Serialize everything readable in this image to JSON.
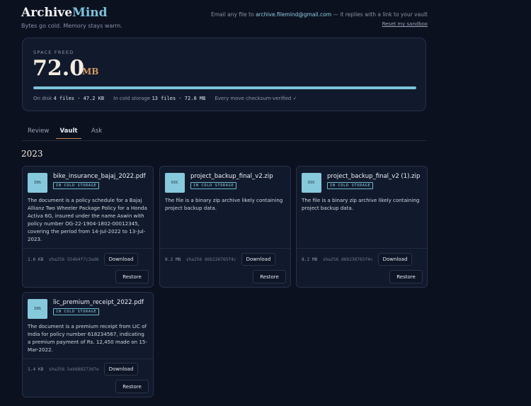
{
  "header": {
    "brand_main": "Archive",
    "brand_accent": "Mind",
    "tagline": "Bytes go cold. Memory stays warm.",
    "email_prefix": "Email any file to ",
    "email_address": "archive.filemind@gmail.com",
    "email_suffix": " — it replies with a link to your vault",
    "reset_link": "Reset my sandbox"
  },
  "stats": {
    "label": "SPACE FREED",
    "value": "72.0",
    "unit": "MB",
    "progress_fraction": 1.0,
    "on_disk_label": "On disk",
    "on_disk_value": "4 files · 47.2 KB",
    "cold_label": "In cold storage",
    "cold_value": "13 files · 72.0 MB",
    "verified": "Every move checksum-verified ✓"
  },
  "tabs": [
    {
      "label": "Review",
      "active": false
    },
    {
      "label": "Vault",
      "active": true
    },
    {
      "label": "Ask",
      "active": false
    }
  ],
  "year": "2023",
  "cards": [
    {
      "badge": "INS",
      "name": "bike_insurance_bajaj_2022.pdf",
      "status": "IN COLD STORAGE",
      "description": "The document is a policy schedule for a Bajaj Allianz Two Wheeler Package Policy for a Honda Activa 6G, insured under the name Aswin with policy number OG-22-1904-1802-00012345, covering the period from 14-Jul-2022 to 13-Jul-2023.",
      "size": "1.6 KB",
      "hash": "sha256 554b4f7c3ad6",
      "download": "Download",
      "restore": "Restore"
    },
    {
      "badge": "DOC",
      "name": "project_backup_final_v2.zip",
      "status": "IN COLD STORAGE",
      "description": "The file is a binary zip archive likely containing project backup data.",
      "size": "8.2 MB",
      "hash": "sha256 d6b238765f4c",
      "download": "Download",
      "restore": "Restore"
    },
    {
      "badge": "DOC",
      "name": "project_backup_final_v2 (1).zip",
      "status": "IN COLD STORAGE",
      "description": "The file is a binary zip archive likely containing project backup data.",
      "size": "8.2 MB",
      "hash": "sha256 d6b238765f4c",
      "download": "Download",
      "restore": "Restore"
    },
    {
      "badge": "INS",
      "name": "lic_premium_receipt_2022.pdf",
      "status": "IN COLD STORAGE",
      "description": "The document is a premium receipt from LIC of India for policy number 618234567, indicating a premium payment of Rs. 12,450 made on 15-Mar-2022.",
      "size": "1.4 KB",
      "hash": "sha256 5eb688273d7e",
      "download": "Download",
      "restore": "Restore"
    }
  ],
  "colors": {
    "accent": "#7cc3d8",
    "warm": "#d59a63",
    "background": "#0c1120",
    "card": "#111a2c"
  }
}
